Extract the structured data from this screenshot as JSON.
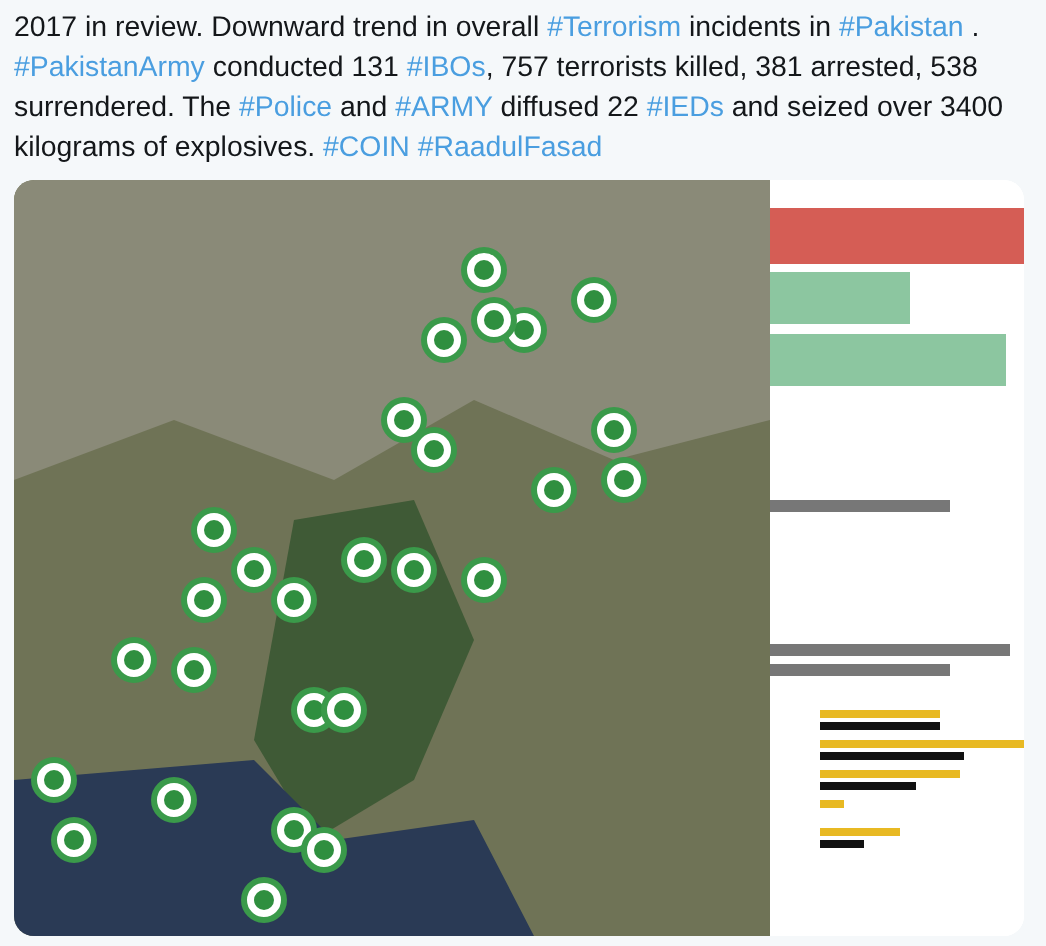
{
  "tweet": {
    "segments": [
      {
        "kind": "text",
        "text": "2017 in review. Downward trend in overall "
      },
      {
        "kind": "hashtag",
        "text": "#Terrorism"
      },
      {
        "kind": "text",
        "text": " incidents in "
      },
      {
        "kind": "hashtag",
        "text": "#Pakistan"
      },
      {
        "kind": "text",
        "text": " . "
      },
      {
        "kind": "hashtag",
        "text": "#PakistanArmy"
      },
      {
        "kind": "text",
        "text": " conducted 131 "
      },
      {
        "kind": "hashtag",
        "text": "#IBOs"
      },
      {
        "kind": "text",
        "text": ", 757 terrorists killed, 381 arrested, 538 surrendered. The "
      },
      {
        "kind": "hashtag",
        "text": "#Police"
      },
      {
        "kind": "text",
        "text": " and "
      },
      {
        "kind": "hashtag",
        "text": "#ARMY"
      },
      {
        "kind": "text",
        "text": " diffused 22 "
      },
      {
        "kind": "hashtag",
        "text": "#IEDs"
      },
      {
        "kind": "text",
        "text": " and seized over 3400 kilograms of explosives. "
      },
      {
        "kind": "hashtag",
        "text": "#COIN"
      },
      {
        "kind": "hashtag",
        "text": "#RaadulFasad"
      }
    ]
  }
}
